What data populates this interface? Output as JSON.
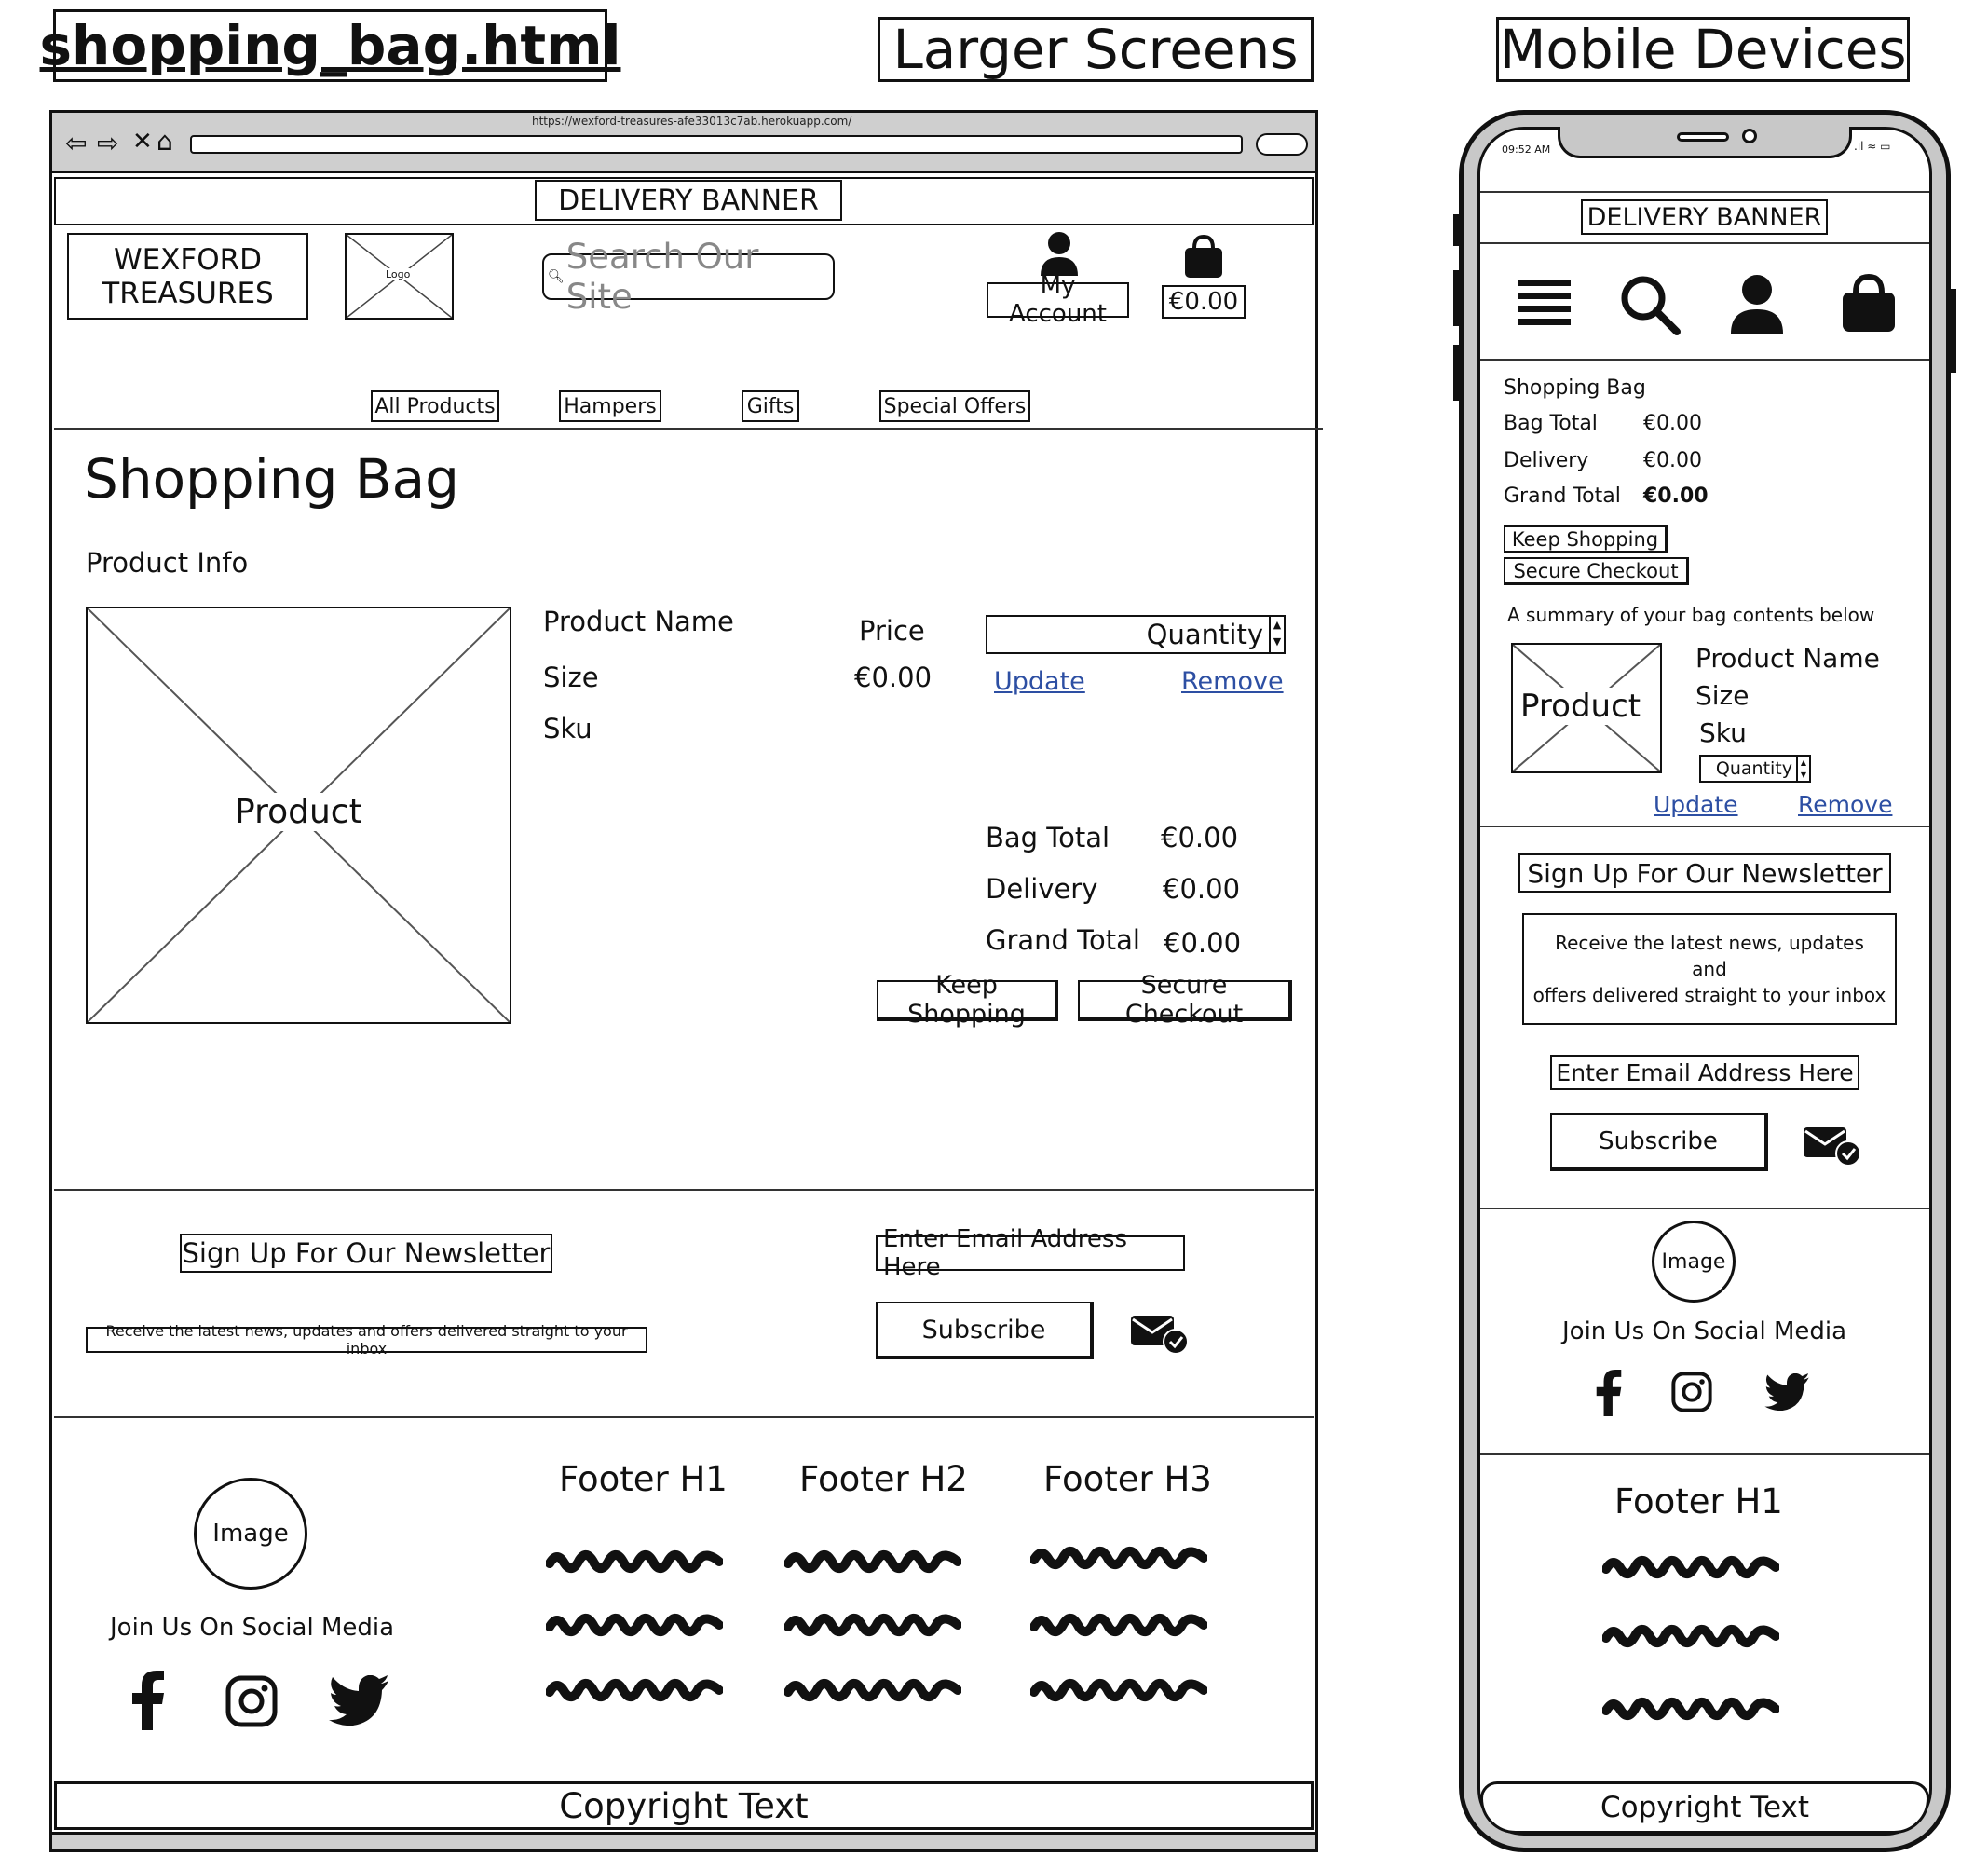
{
  "headers": {
    "file_title": "shopping_bag.html",
    "desktop_label": "Larger Screens",
    "mobile_label": "Mobile Devices"
  },
  "desktop": {
    "url": "https://wexford-treasures-afe33013c7ab.herokuapp.com/",
    "delivery_banner": "DELIVERY BANNER",
    "brand": [
      "WEXFORD",
      "TREASURES"
    ],
    "logo_text": "Logo",
    "search_placeholder": "Search Our Site",
    "account_label": "My Account",
    "bag_amount": "€0.00",
    "nav": [
      "All Products",
      "Hampers",
      "Gifts",
      "Special Offers"
    ],
    "page_title": "Shopping Bag",
    "product_info_heading": "Product Info",
    "product_image_label": "Product",
    "product_name": "Product Name",
    "size_label": "Size",
    "sku_label": "Sku",
    "price_heading": "Price",
    "price_value": "€0.00",
    "quantity_label": "Quantity",
    "update_link": "Update",
    "remove_link": "Remove",
    "totals": [
      {
        "label": "Bag Total",
        "value": "€0.00"
      },
      {
        "label": "Delivery",
        "value": "€0.00"
      },
      {
        "label": "Grand Total",
        "value": "€0.00"
      }
    ],
    "keep_shopping": "Keep Shopping",
    "secure_checkout": "Secure Checkout",
    "newsletter_heading": "Sign Up For Our Newsletter",
    "newsletter_text": "Receive the latest news, updates and offers delivered straight to your inbox",
    "email_placeholder": "Enter Email Address Here",
    "subscribe": "Subscribe",
    "footer_image": "Image",
    "social_heading": "Join Us On Social Media",
    "footer_headings": [
      "Footer H1",
      "Footer H2",
      "Footer H3"
    ],
    "copyright": "Copyright Text"
  },
  "mobile": {
    "time": "09:52 AM",
    "delivery_banner": "DELIVERY BANNER",
    "summary_title": "Shopping Bag",
    "totals": [
      {
        "label": "Bag Total",
        "value": "€0.00"
      },
      {
        "label": "Delivery",
        "value": "€0.00"
      },
      {
        "label": "Grand Total",
        "value": "€0.00"
      }
    ],
    "keep_shopping": "Keep Shopping",
    "secure_checkout": "Secure Checkout",
    "summary_text": "A summary of your bag contents below",
    "product_image_label": "Product",
    "product_name": "Product Name",
    "size_label": "Size",
    "sku_label": "Sku",
    "quantity_label": "Quantity",
    "update_link": "Update",
    "remove_link": "Remove",
    "newsletter_heading": "Sign Up For Our Newsletter",
    "newsletter_text": [
      "Receive the latest news, updates",
      "and",
      "offers delivered straight to your inbox"
    ],
    "email_placeholder": "Enter Email Address Here",
    "subscribe": "Subscribe",
    "footer_image": "Image",
    "social_heading": "Join Us On Social Media",
    "footer_heading": "Footer H1",
    "copyright": "Copyright Text"
  }
}
